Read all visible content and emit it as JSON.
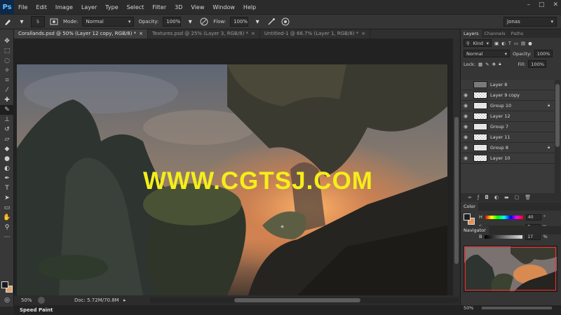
{
  "app": {
    "logo": "Ps",
    "menu": [
      "File",
      "Edit",
      "Image",
      "Layer",
      "Type",
      "Select",
      "Filter",
      "3D",
      "View",
      "Window",
      "Help"
    ],
    "window_controls": [
      "–",
      "□",
      "✕"
    ]
  },
  "options": {
    "brush_size": "5",
    "mode_label": "Mode:",
    "mode_value": "Normal",
    "opacity_label": "Opacity:",
    "opacity_value": "100%",
    "flow_label": "Flow:",
    "flow_value": "100%",
    "workspace": "Jonas"
  },
  "tabs": [
    {
      "label": "Corallands.psd @ 50% (Layer 12 copy, RGB/8) *",
      "active": true
    },
    {
      "label": "Textures.psd @ 25% (Layer 3, RGB/8) *",
      "active": false
    },
    {
      "label": "Untitled-1 @ 66.7% (Layer 1, RGB/8) *",
      "active": false
    }
  ],
  "canvas": {
    "watermark": "WWW.CGTSJ.COM"
  },
  "status": {
    "zoom": "50%",
    "doc": "Doc: 5.72M/70.8M"
  },
  "bottom_bar": {
    "mini_tab": "Speed Paint"
  },
  "panels": {
    "layers_tabs": [
      "Layers",
      "Channels",
      "Paths"
    ],
    "kind": "Kind",
    "blend_mode": "Normal",
    "opacity_label": "Opacity:",
    "opacity_value": "100%",
    "lock_label": "Lock:",
    "fill_label": "Fill:",
    "fill_value": "100%",
    "layers": [
      {
        "name": "Layer 8",
        "thumb": "grey",
        "visible": false,
        "locked": false
      },
      {
        "name": "Layer 9 copy",
        "thumb": "checker",
        "visible": true,
        "locked": false
      },
      {
        "name": "Group 10",
        "thumb": "folder",
        "visible": true,
        "locked": true
      },
      {
        "name": "Layer 12",
        "thumb": "checker",
        "visible": true,
        "locked": false
      },
      {
        "name": "Group 7",
        "thumb": "folder",
        "visible": true,
        "locked": false
      },
      {
        "name": "Layer 11",
        "thumb": "checker",
        "visible": true,
        "locked": false
      },
      {
        "name": "Group 8",
        "thumb": "folder",
        "visible": true,
        "locked": true
      },
      {
        "name": "Layer 10",
        "thumb": "checker",
        "visible": true,
        "locked": false
      }
    ],
    "color_title": "Color",
    "color_sliders": [
      {
        "label": "H",
        "value": "40",
        "unit": "°"
      },
      {
        "label": "S",
        "value": "7",
        "unit": "%"
      },
      {
        "label": "B",
        "value": "17",
        "unit": "%"
      }
    ],
    "navigator_title": "Navigator",
    "navigator_zoom": "50%"
  }
}
